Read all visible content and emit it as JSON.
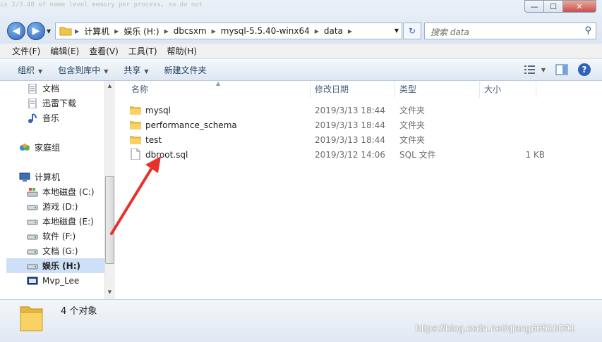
{
  "background_code": "is 2/3.40 of name level memory per process, so do not",
  "window_controls": {
    "minimize": "—",
    "maximize": "☐",
    "close": "✕"
  },
  "address": {
    "crumbs": [
      "计算机",
      "娱乐 (H:)",
      "dbcsxm",
      "mysql-5.5.40-winx64",
      "data"
    ]
  },
  "search": {
    "placeholder": "搜索 data"
  },
  "menu": [
    "文件(F)",
    "编辑(E)",
    "查看(V)",
    "工具(T)",
    "帮助(H)"
  ],
  "toolbar": {
    "organize": "组织",
    "include_library": "包含到库中",
    "share": "共享",
    "new_folder": "新建文件夹"
  },
  "nav": {
    "items": [
      {
        "label": "文档",
        "icon": "document-icon"
      },
      {
        "label": "迅雷下载",
        "icon": "document-icon"
      },
      {
        "label": "音乐",
        "icon": "music-icon"
      },
      {
        "label": "家庭组",
        "icon": "homegroup-icon"
      },
      {
        "label": "计算机",
        "icon": "computer-icon"
      },
      {
        "label": "本地磁盘 (C:)",
        "icon": "system-drive-icon"
      },
      {
        "label": "游戏 (D:)",
        "icon": "drive-icon"
      },
      {
        "label": "本地磁盘 (E:)",
        "icon": "drive-icon"
      },
      {
        "label": "软件 (F:)",
        "icon": "drive-icon"
      },
      {
        "label": "文档 (G:)",
        "icon": "drive-icon"
      },
      {
        "label": "娱乐 (H:)",
        "icon": "drive-icon",
        "selected": true
      },
      {
        "label": "Mvp_Lee",
        "icon": "network-drive-icon"
      }
    ]
  },
  "columns": {
    "name": "名称",
    "date": "修改日期",
    "type": "类型",
    "size": "大小"
  },
  "files": [
    {
      "name": "mysql",
      "date": "2019/3/13 18:44",
      "type": "文件夹",
      "size": "",
      "icon": "folder-icon"
    },
    {
      "name": "performance_schema",
      "date": "2019/3/13 18:44",
      "type": "文件夹",
      "size": "",
      "icon": "folder-icon"
    },
    {
      "name": "test",
      "date": "2019/3/13 18:44",
      "type": "文件夹",
      "size": "",
      "icon": "folder-icon"
    },
    {
      "name": "dbroot.sql",
      "date": "2019/3/12 14:06",
      "type": "SQL 文件",
      "size": "1 KB",
      "icon": "file-icon"
    }
  ],
  "status": {
    "count": "4 个对象"
  },
  "watermark": "https://blog.csdn.net/qiang66510091",
  "colors": {
    "accent": "#2d64b8",
    "arrow": "#e8312a",
    "folder": "#f4c542"
  }
}
